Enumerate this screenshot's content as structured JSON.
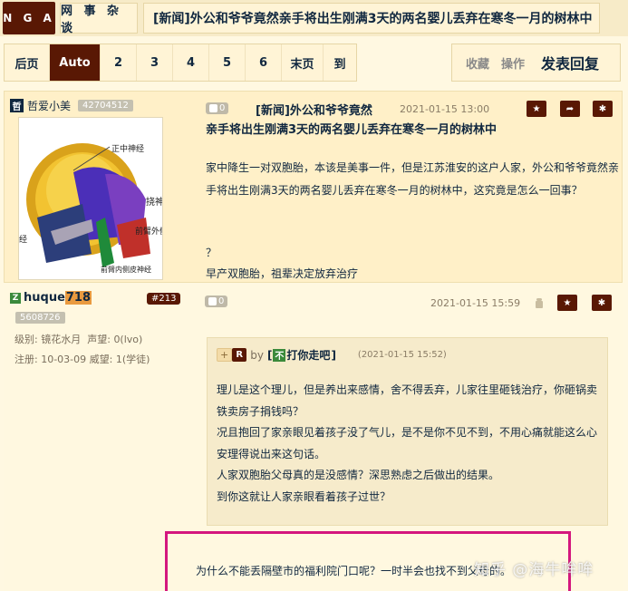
{
  "topbar": {
    "logo": "N G A",
    "forum": "网 事 杂 谈",
    "thread_title": "[新闻]外公和爷爷竟然亲手将出生刚满3天的两名婴儿丢弃在寒冬一月的树林中"
  },
  "pager": {
    "items": [
      "后页",
      "Auto",
      "2",
      "3",
      "4",
      "5",
      "6",
      "末页",
      "到"
    ]
  },
  "actions": {
    "favorite": "收藏",
    "operate": "操作",
    "reply": "发表回复"
  },
  "post1": {
    "username": "哲爱小美",
    "user_badge": "哲",
    "uid": "42704512",
    "likes": "0",
    "date": "2021-01-15 13:00",
    "title_line1": "[新闻]外公和爷爷竟然",
    "title_line2": "亲手将出生刚满3天的两名婴儿丢弃在寒冬一月的树林中",
    "body": "家中降生一对双胞胎，本该是美事一件，但是江苏淮安的这户人家，外公和爷爷竟然亲手将出生刚满3天的两名婴儿丢弃在寒冬一月的树林中，这究竟是怎么一回事？",
    "question": "？",
    "body_extra": "早产双胞胎，祖辈决定放弃治疗",
    "avatar_labels": [
      "正中神经",
      "挠神",
      "前臂外侧",
      "经",
      "前臂内侧皮神经"
    ]
  },
  "post2": {
    "badge": "Z",
    "username_prefix": "huque",
    "username_num": "718",
    "floor": "#213",
    "uid": "5608726",
    "level_label": "级别:",
    "level": "镜花水月",
    "fame_label": "声望:",
    "fame": "0(lvo)",
    "reg_label": "注册:",
    "reg_date": "10-03-09",
    "prestige_label": "威望:",
    "prestige": "1(学徒)",
    "likes": "0",
    "date": "2021-01-15 15:59",
    "quote": {
      "plus": "+",
      "r": "R",
      "by": "by",
      "name_badge": "不",
      "name": "打你走吧",
      "bracket_open": "[",
      "bracket_close": "]",
      "date": "(2021-01-15 15:52)",
      "lines": [
        "理儿是这个理儿，但是养出来感情，舍不得丢弃，儿家往里砸钱治疗，你砸锅卖铁卖房子捐钱吗？",
        "况且抱回了家亲眼见着孩子没了气儿，是不是你不见不到，不用心痛就能这么心安理得说出来这句话。",
        "人家双胞胎父母真的是没感情？深思熟虑之后做出的结果。",
        "到你这就让人家亲眼看着孩子过世？"
      ]
    },
    "last_line": "为什么不能丢隔壁市的福利院门口呢？一时半会也找不到父母的。",
    "watermark": "知乎 @海牛哞哞"
  },
  "colors": {
    "brand": "#591804",
    "background": "#fff8e1",
    "highlight_box": "#d4177e"
  }
}
